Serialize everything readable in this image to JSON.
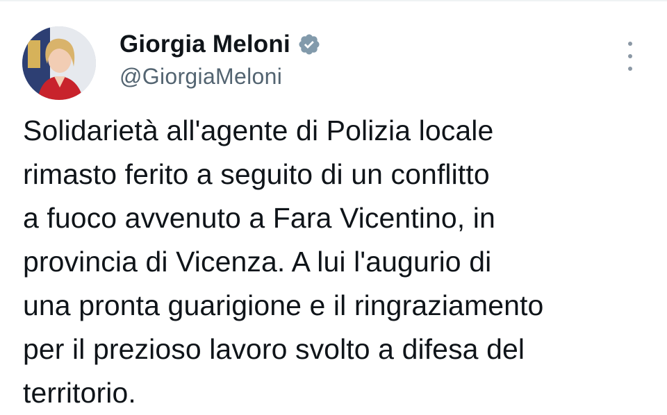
{
  "tweet": {
    "author": {
      "display_name": "Giorgia Meloni",
      "handle": "@GiorgiaMeloni",
      "verified": true,
      "verified_badge_color": "#829aab"
    },
    "text_lines": [
      "Solidarietà all'agente di Polizia locale",
      "rimasto ferito a seguito di un conflitto",
      "a fuoco avvenuto a Fara Vicentino, in",
      "provincia di Vicenza. A lui l'augurio di",
      "una pronta guarigione e il ringraziamento",
      "per il prezioso lavoro svolto a difesa del",
      "territorio."
    ],
    "icons": {
      "verified": "verified-badge-icon",
      "more": "more-vertical-icon"
    }
  }
}
